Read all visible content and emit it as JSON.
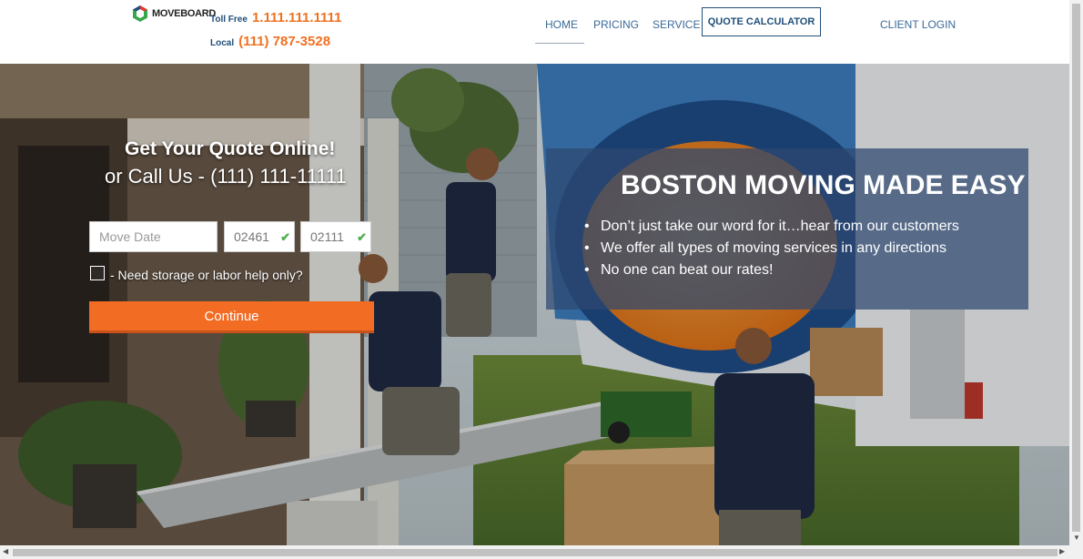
{
  "header": {
    "logo_text": "MOVEBOARD",
    "toll_free_label": "Toll Free",
    "toll_free_number": "1.111.111.1111",
    "local_label": "Local",
    "local_number": "(111) 787-3528"
  },
  "nav": {
    "home": "HOME",
    "pricing": "PRICING",
    "service": "SERVICE",
    "quote_calculator": "QUOTE CALCULATOR",
    "client_login": "CLIENT LOGIN"
  },
  "quote_form": {
    "title": "Get Your Quote Online!",
    "subtitle": "or Call Us - (111) 111-11111",
    "move_date_placeholder": "Move Date",
    "zip_from": "02461",
    "zip_to": "02111",
    "storage_label": "- Need storage or labor help only?",
    "continue_label": "Continue"
  },
  "promo": {
    "title": "BOSTON MOVING MADE EASY",
    "bullets": [
      "Don’t just take our word for it…hear from our customers",
      "We offer all types of moving services in any directions",
      "No one can beat our rates!"
    ]
  },
  "colors": {
    "accent_orange": "#f26c23",
    "brand_blue": "#1f4e79",
    "promo_overlay": "#2c4870"
  }
}
